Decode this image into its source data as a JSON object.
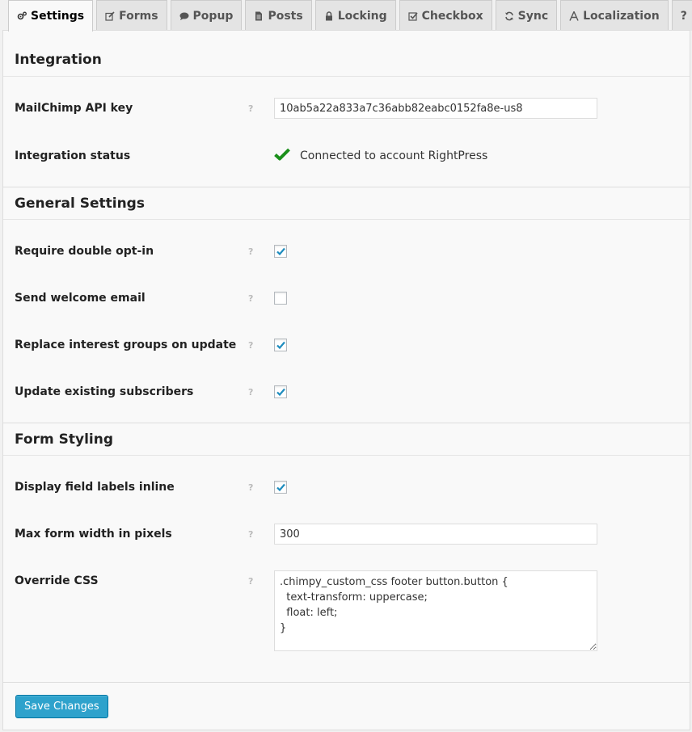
{
  "tabs": [
    {
      "label": "Settings",
      "icon": "gears-icon"
    },
    {
      "label": "Forms",
      "icon": "edit-icon"
    },
    {
      "label": "Popup",
      "icon": "comment-icon"
    },
    {
      "label": "Posts",
      "icon": "file-icon"
    },
    {
      "label": "Locking",
      "icon": "lock-icon"
    },
    {
      "label": "Checkbox",
      "icon": "check-square-icon"
    },
    {
      "label": "Sync",
      "icon": "refresh-icon"
    },
    {
      "label": "Localization",
      "icon": "font-icon"
    },
    {
      "label": "?",
      "icon": ""
    }
  ],
  "active_tab": "Settings",
  "help_glyph": "?",
  "integration": {
    "title": "Integration",
    "api_key_label": "MailChimp API key",
    "api_key_value": "10ab5a22a833a7c36abb82eabc0152fa8e-us8",
    "status_label": "Integration status",
    "status_text": "Connected to account RightPress",
    "status_color": "#1a8f1a"
  },
  "general": {
    "title": "General Settings",
    "items": [
      {
        "label": "Require double opt-in",
        "checked": true
      },
      {
        "label": "Send welcome email",
        "checked": false
      },
      {
        "label": "Replace interest groups on update",
        "checked": true
      },
      {
        "label": "Update existing subscribers",
        "checked": true
      }
    ]
  },
  "styling": {
    "title": "Form Styling",
    "inline_label": "Display field labels inline",
    "inline_checked": true,
    "width_label": "Max form width in pixels",
    "width_value": "300",
    "css_label": "Override CSS",
    "css_value": ".chimpy_custom_css footer button.button {\n  text-transform: uppercase;\n  float: left;\n}"
  },
  "save_label": "Save Changes",
  "accent_color": "#2ea2cc",
  "check_color": "#1e8cbe"
}
